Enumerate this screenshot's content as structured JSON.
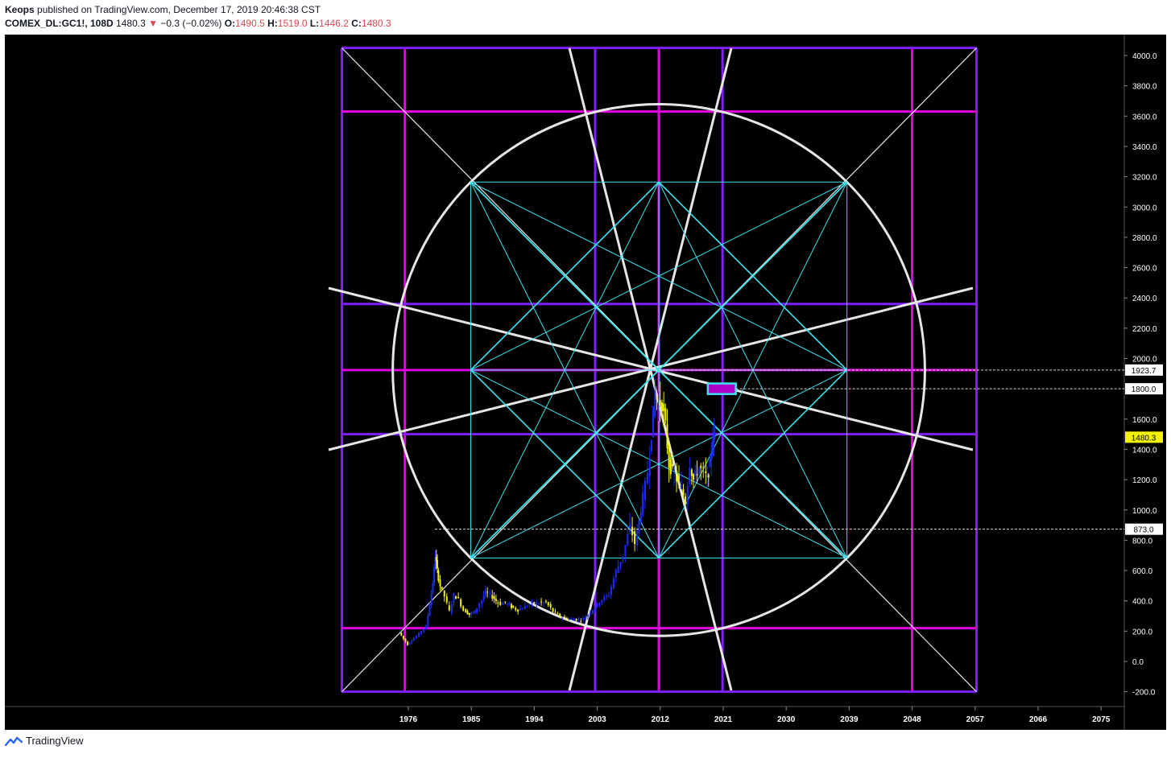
{
  "header": {
    "author": "Keops",
    "published_text": "published on TradingView.com, December 17, 2019 20:46:38 CST",
    "symbol": "COMEX_DL:GC1!, 108D",
    "last": "1480.3",
    "change": "−0.3 (−0.02%)",
    "o_label": "O:",
    "o_value": "1490.5",
    "h_label": "H:",
    "h_value": "1519.0",
    "l_label": "L:",
    "l_value": "1446.2",
    "c_label": "C:",
    "c_value": "1480.3"
  },
  "footer": {
    "brand": "TradingView"
  },
  "colors": {
    "background": "#000000",
    "axis_text": "#ffffff",
    "purple": "#7f1fff",
    "magenta": "#e000e0",
    "cyan": "#3de2ee",
    "circle": "#e6e6e6",
    "bull_bar": "#1a2bff",
    "bear_bar": "#f5ef1f",
    "price_marker_bg": "#f5f500"
  },
  "chart_data": {
    "type": "candlestick",
    "symbol": "COMEX_DL:GC1!",
    "timeframe": "108D",
    "xlim": [
      1966.5,
      2086
    ],
    "ylim": [
      -230,
      4060
    ],
    "x_ticks": [
      "1976",
      "1985",
      "1994",
      "2003",
      "2012",
      "2021",
      "2030",
      "2039",
      "2048",
      "2057",
      "2066",
      "2075"
    ],
    "y_ticks": [
      "4000.0",
      "3800.0",
      "3600.0",
      "3400.0",
      "3200.0",
      "3000.0",
      "2800.0",
      "2600.0",
      "2400.0",
      "2200.0",
      "2000.0",
      "1600.0",
      "1400.0",
      "1200.0",
      "1000.0",
      "800.0",
      "600.0",
      "400.0",
      "200.0",
      "0.0",
      "-200.0"
    ],
    "price_labels": [
      {
        "value": 1923.7,
        "label": "1923.7",
        "style": "white"
      },
      {
        "value": 1800.0,
        "label": "1800.0",
        "style": "white"
      },
      {
        "value": 1480.3,
        "label": "1480.3",
        "style": "yellow"
      },
      {
        "value": 873.0,
        "label": "873.0",
        "style": "white"
      }
    ],
    "price_path": [
      [
        1975.0,
        190
      ],
      [
        1975.6,
        150
      ],
      [
        1976.2,
        110
      ],
      [
        1976.8,
        140
      ],
      [
        1977.5,
        165
      ],
      [
        1978.2,
        200
      ],
      [
        1978.8,
        230
      ],
      [
        1979.3,
        380
      ],
      [
        1979.7,
        520
      ],
      [
        1980.0,
        700
      ],
      [
        1980.3,
        600
      ],
      [
        1980.8,
        500
      ],
      [
        1981.5,
        430
      ],
      [
        1982.2,
        330
      ],
      [
        1982.8,
        440
      ],
      [
        1983.5,
        410
      ],
      [
        1984.2,
        340
      ],
      [
        1985.0,
        310
      ],
      [
        1985.8,
        330
      ],
      [
        1986.5,
        380
      ],
      [
        1987.3,
        460
      ],
      [
        1988.0,
        440
      ],
      [
        1988.8,
        400
      ],
      [
        1989.5,
        380
      ],
      [
        1990.2,
        390
      ],
      [
        1991.0,
        360
      ],
      [
        1992.0,
        340
      ],
      [
        1993.0,
        360
      ],
      [
        1994.0,
        385
      ],
      [
        1995.0,
        385
      ],
      [
        1996.0,
        390
      ],
      [
        1997.0,
        330
      ],
      [
        1998.0,
        295
      ],
      [
        1999.0,
        280
      ],
      [
        2000.0,
        280
      ],
      [
        2001.0,
        270
      ],
      [
        2002.0,
        310
      ],
      [
        2003.0,
        360
      ],
      [
        2004.0,
        410
      ],
      [
        2005.0,
        440
      ],
      [
        2006.0,
        600
      ],
      [
        2007.0,
        700
      ],
      [
        2008.0,
        900
      ],
      [
        2008.7,
        780
      ],
      [
        2009.5,
        1000
      ],
      [
        2010.5,
        1250
      ],
      [
        2011.0,
        1500
      ],
      [
        2011.5,
        1780
      ],
      [
        2012.0,
        1680
      ],
      [
        2012.5,
        1700
      ],
      [
        2013.0,
        1550
      ],
      [
        2013.5,
        1300
      ],
      [
        2014.0,
        1250
      ],
      [
        2015.0,
        1180
      ],
      [
        2015.9,
        1060
      ],
      [
        2016.5,
        1300
      ],
      [
        2017.0,
        1200
      ],
      [
        2017.8,
        1280
      ],
      [
        2018.5,
        1250
      ],
      [
        2018.9,
        1200
      ],
      [
        2019.3,
        1300
      ],
      [
        2019.7,
        1480
      ],
      [
        2019.96,
        1480.3
      ]
    ],
    "geometry_overlay": {
      "square": {
        "x": [
          1966.5,
          2057.2
        ],
        "y": [
          -200,
          4050
        ]
      },
      "center": {
        "x": 2011.8,
        "y": 1923.7
      },
      "circle_radius_price": 1755,
      "purple_verticals": [
        1966.5,
        2002.7,
        2020.9,
        2057.2
      ],
      "magenta_verticals": [
        1975.5,
        2011.8,
        2048.0
      ],
      "purple_horizontals": [
        4050,
        2360,
        1500,
        -200
      ],
      "magenta_horizontals": [
        3630,
        1923.7,
        220
      ],
      "highlight_box": {
        "x": [
          2018.8,
          2022.8
        ],
        "y": [
          1765,
          1835
        ]
      }
    }
  }
}
